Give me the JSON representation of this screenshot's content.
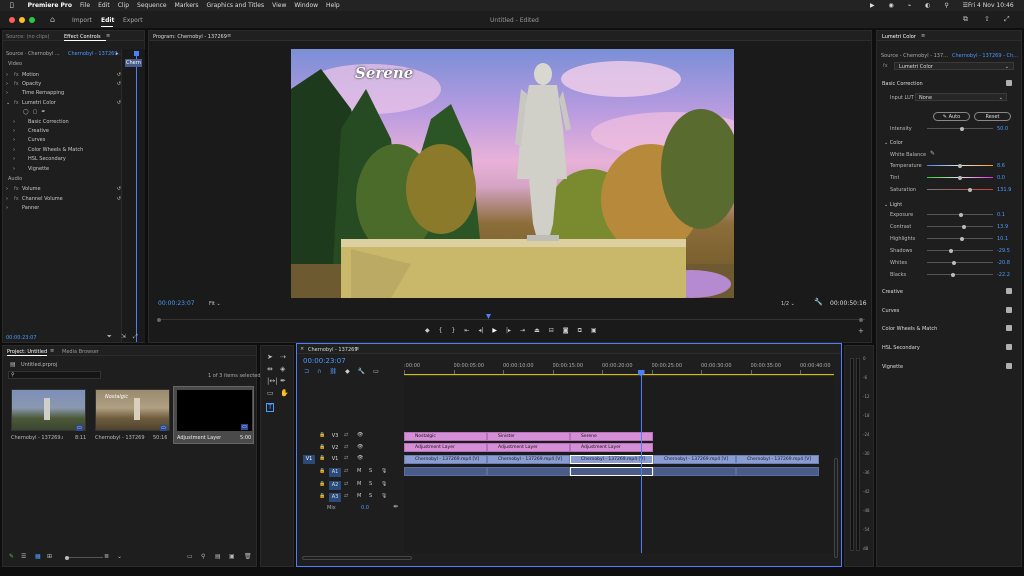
{
  "menubar": {
    "app_name": "Premiere Pro",
    "items": [
      "File",
      "Edit",
      "Clip",
      "Sequence",
      "Markers",
      "Graphics and Titles",
      "View",
      "Window",
      "Help"
    ],
    "clock": "Fri 4 Nov  10:46"
  },
  "header": {
    "tabs": [
      "Import",
      "Edit",
      "Export"
    ],
    "active_tab": "Edit",
    "doc_title": "Untitled",
    "doc_status": "- Edited"
  },
  "effect_controls": {
    "tab_source": "Source: (no clips)",
    "tab_active": "Effect Controls",
    "source_label": "Source · Chernobyl ...",
    "seq_label": "Chernobyl - 137269 ...",
    "mini_clip": "Chern",
    "sections": {
      "video": "Video",
      "audio": "Audio"
    },
    "video_items": [
      "Motion",
      "Opacity",
      "Time Remapping",
      "Lumetri Color"
    ],
    "lumetri_sub": [
      "Basic Correction",
      "Creative",
      "Curves",
      "Color Wheels & Match",
      "HSL Secondary",
      "Vignette"
    ],
    "audio_items": [
      "Volume",
      "Channel Volume",
      "Panner"
    ],
    "timecode": "00:00:23:07"
  },
  "program": {
    "tab": "Program: Chernobyl - 137269",
    "overlay_title": "Serene",
    "timecode": "00:00:23:07",
    "fit": "Fit",
    "resolution": "1/2",
    "duration": "00:00:50:16"
  },
  "project": {
    "tab_active": "Project: Untitled",
    "tab_media": "Media Browser",
    "file": "Untitled.prproj",
    "items_selected": "1 of 3 items selected",
    "items": [
      {
        "name": "Chernobyl - 137269.mp4",
        "duration": "8:11"
      },
      {
        "name": "Chernobyl - 137269",
        "duration": "50:16"
      },
      {
        "name": "Adjustment Layer",
        "duration": "5:00"
      }
    ],
    "thumb_text": "Nostalgic"
  },
  "timeline": {
    "tab": "Chernobyl - 137269",
    "timecode": "00:00:23:07",
    "ruler": [
      ":00:00",
      "00:00:05:00",
      "00:00:10:00",
      "00:00:15:00",
      "00:00:20:00",
      "00:00:25:00",
      "00:00:30:00",
      "00:00:35:00",
      "00:00:40:00"
    ],
    "tracks": [
      "V3",
      "V2",
      "V1",
      "A1",
      "A2",
      "A3"
    ],
    "v1_source": "V1",
    "mix_label": "Mix",
    "mix_value": "0.0",
    "titles": [
      "Nostalgic",
      "Sinister",
      "Serene"
    ],
    "adjust": [
      "Adjustment Layer",
      "Adjustment Layer",
      "Adjustment Layer"
    ],
    "video_clips": [
      "Chernobyl - 137269.mp4 [V]",
      "Chernobyl - 137269.mp4 [V]",
      "Chernobyl - 137269.mp4 [V]",
      "Chernobyl - 137269.mp4 [V]",
      "Chernobyl - 137269.mp4 [V]"
    ],
    "meter_ticks": [
      "0",
      "-6",
      "-12",
      "-18",
      "-24",
      "-30",
      "-36",
      "-42",
      "-48",
      "-54",
      "dB"
    ],
    "playhead_fraction": 0.55
  },
  "lumetri": {
    "title": "Lumetri Color",
    "source": "Source - Chernobyl - 137...",
    "seq": "Chernobyl - 137269 - Ch...",
    "effect": "Lumetri Color",
    "basic": "Basic Correction",
    "input_lut_label": "Input LUT",
    "input_lut_value": "None",
    "auto": "Auto",
    "reset": "Reset",
    "intensity_label": "Intensity",
    "intensity_value": "50.0",
    "color_section": "Color",
    "white_balance": "White Balance",
    "light_section": "Light",
    "sliders_color": [
      {
        "label": "Temperature",
        "value": "8.6",
        "pos": 0.5
      },
      {
        "label": "Tint",
        "value": "0.0",
        "pos": 0.5
      },
      {
        "label": "Saturation",
        "value": "131.9",
        "pos": 0.66
      }
    ],
    "sliders_light": [
      {
        "label": "Exposure",
        "value": "0.1",
        "pos": 0.52
      },
      {
        "label": "Contrast",
        "value": "13.9",
        "pos": 0.56
      },
      {
        "label": "Highlights",
        "value": "10.1",
        "pos": 0.53
      },
      {
        "label": "Shadows",
        "value": "-29.5",
        "pos": 0.35
      },
      {
        "label": "Whites",
        "value": "-20.8",
        "pos": 0.4
      },
      {
        "label": "Blacks",
        "value": "-22.2",
        "pos": 0.39
      }
    ],
    "sections": [
      "Creative",
      "Curves",
      "Color Wheels & Match",
      "HSL Secondary",
      "Vignette"
    ]
  },
  "colors": {
    "accent": "#4a9bff",
    "title_clip": "#d48fd6",
    "video_clip": "#8a9cd0",
    "playhead": "#4a7fff"
  }
}
